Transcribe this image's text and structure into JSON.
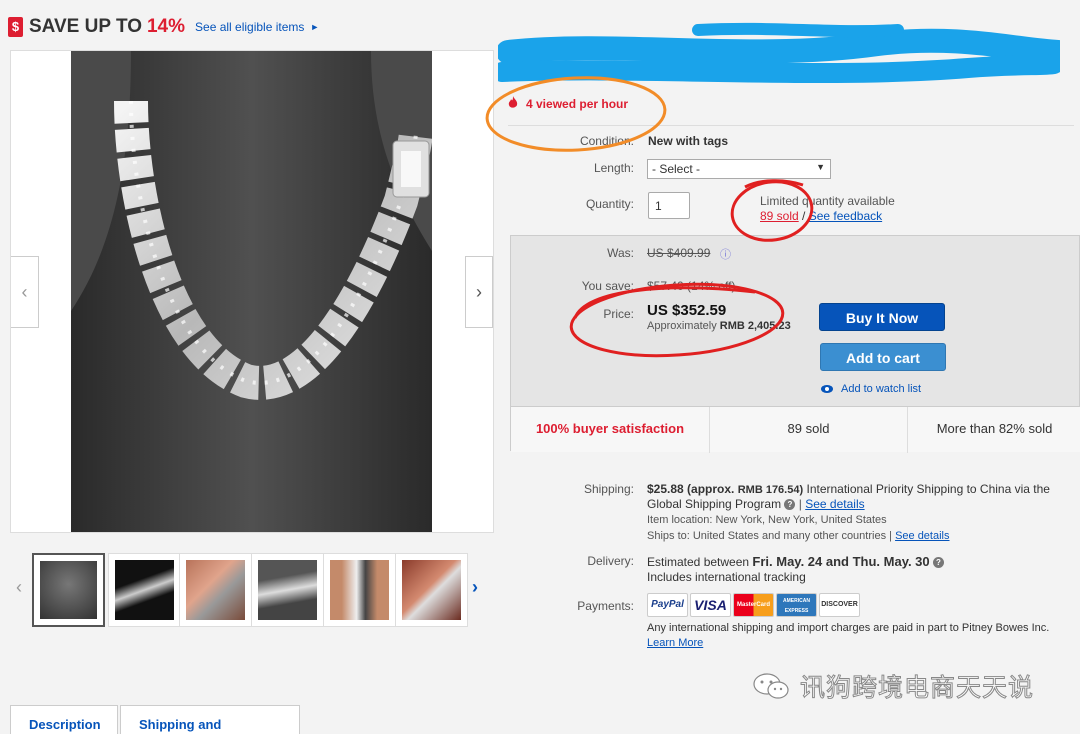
{
  "promo": {
    "icon": "$",
    "prefix": "SAVE UP TO",
    "percent": "14%",
    "link": "See all eligible items",
    "arrow": "►"
  },
  "gallery": {
    "prev": "‹",
    "next": "›",
    "thumb_prev": "‹",
    "thumb_next": "›"
  },
  "tabs": {
    "description": "Description",
    "shipping": "Shipping and payments"
  },
  "listing": {
    "viewed": "4 viewed per hour",
    "condition_label": "Condition:",
    "condition_value": "New with tags",
    "length_label": "Length:",
    "length_selected": "- Select -",
    "quantity_label": "Quantity:",
    "quantity_value": "1",
    "limited": "Limited quantity available",
    "sold_link": "89 sold",
    "sold_sep": "/",
    "feedback_link": "See feedback"
  },
  "price": {
    "was_label": "Was:",
    "was_value": "US $409.99",
    "save_label": "You save:",
    "save_value": "$57.40 (14% off)",
    "price_label": "Price:",
    "price_value": "US $352.59",
    "approx_prefix": "Approximately ",
    "approx_value": "RMB 2,405.23",
    "buy_now": "Buy It Now",
    "add_to_cart": "Add to cart",
    "watch": "Add to watch list"
  },
  "stats": {
    "satisfaction": "100% buyer satisfaction",
    "sold": "89 sold",
    "percent_sold": "More than 82% sold"
  },
  "shipping": {
    "label": "Shipping:",
    "amount": "$25.88 (approx.",
    "amount_rmb": "RMB 176.54)",
    "method": "International Priority Shipping to China",
    "via": "via the",
    "program": "Global Shipping Program",
    "see_details": "See details",
    "location": "Item location:  New York, New York, United States",
    "ships_to": "Ships to:  United States and many other countries",
    "ships_details": "See details"
  },
  "delivery": {
    "label": "Delivery:",
    "estimated": "Estimated between",
    "range": "Fri. May. 24 and Thu. May. 30",
    "tracking": "Includes international tracking"
  },
  "payments": {
    "label": "Payments:",
    "methods": [
      "PayPal",
      "VISA",
      "MasterCard",
      "AMERICAN EXPRESS",
      "DISCOVER"
    ],
    "note": "Any international shipping and import charges are paid in part to Pitney Bowes Inc.",
    "learn_more": "Learn More"
  },
  "watermark": {
    "text": "讯狗跨境电商天天说"
  },
  "colors": {
    "ebay_blue": "#0654ba",
    "alert_red": "#dd1e31",
    "annotation_orange": "#f28c28",
    "annotation_red": "#e02020",
    "scribble_blue": "#1aa3ea"
  }
}
